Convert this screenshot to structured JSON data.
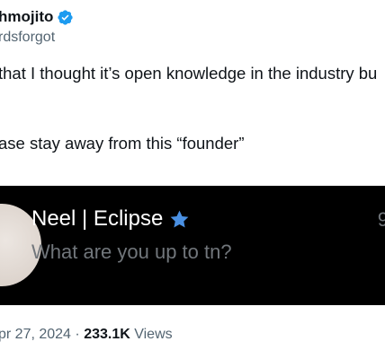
{
  "author": {
    "name": "hmojito",
    "handle": "rdsforgot"
  },
  "tweet": {
    "line1": "that I  thought it’s open knowledge in the industry bu",
    "line2": "ase stay away from this “founder”"
  },
  "embed": {
    "name": "Neel | Eclipse",
    "prompt": "What are you up to tn?",
    "cut_text": "9"
  },
  "meta": {
    "date": "pr 27, 2024",
    "separator": "·",
    "views_count": "233.1K",
    "views_label": "Views"
  },
  "colors": {
    "verified_badge": "#1d9bf0",
    "star": "#4a90e2",
    "secondary_text": "#536471",
    "embed_background": "#000000"
  }
}
